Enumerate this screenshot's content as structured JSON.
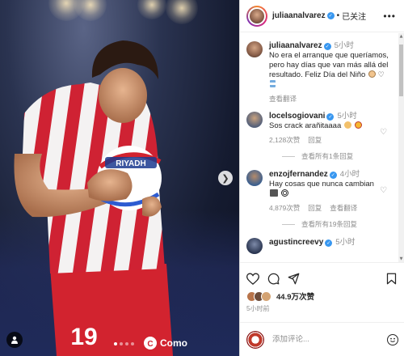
{
  "post": {
    "author": "juliaanalvarez",
    "follow_status": "已关注",
    "separator": "•",
    "more_label": "•••",
    "photo": {
      "jersey_number": "19",
      "sponsor_text": "RIYADH",
      "sleeve_sponsor": "Como",
      "carousel_total": 4,
      "carousel_active": 1
    }
  },
  "comments": [
    {
      "username": "juliaanalvarez",
      "verified": true,
      "time": "5小时",
      "text": "No era el arranque que queríamos, pero hay días que van más allá del resultado. Feliz Día del Niño",
      "emojis": [
        "face-emoji",
        "heart-outline-emoji",
        "flag-emoji"
      ],
      "actions": [
        "查看翻译"
      ],
      "avatar_color": "#a77e62"
    },
    {
      "username": "locelsogiovani",
      "verified": true,
      "time": "5小时",
      "text": "Sos crack arañitaaaa",
      "emojis": [
        "clap-emoji",
        "laugh-emoji"
      ],
      "actions": [
        "2,128次赞",
        "回复"
      ],
      "replies": "查看所有1条回复",
      "avatar_color": "#54607a"
    },
    {
      "username": "enzojfernandez",
      "verified": true,
      "time": "4小时",
      "text": "Hay cosas que nunca cambian",
      "emojis": [
        "goal-emoji",
        "ball-emoji"
      ],
      "actions": [
        "4,879次赞",
        "回复",
        "查看翻译"
      ],
      "replies": "查看所有19条回复",
      "avatar_color": "#3b5f8f"
    },
    {
      "username": "agustincreevy",
      "verified": true,
      "time": "5小时",
      "text": "",
      "emojis": [],
      "actions": [],
      "avatar_color": "#2a3550"
    }
  ],
  "engagement": {
    "likes": "44.9万次赞",
    "posted": "5小时前",
    "like_avatars": [
      "#b8744a",
      "#6d4c3a",
      "#d4a373"
    ]
  },
  "composer": {
    "placeholder": "添加评论..."
  },
  "icons": {
    "like": "heart-icon",
    "comment": "comment-icon",
    "share": "share-icon",
    "save": "bookmark-icon",
    "emoji": "emoji-icon",
    "next": "chevron-right-icon",
    "tag": "user-tag-icon"
  },
  "colors": {
    "verified": "#3897f0",
    "link_gray": "#8e8e8e",
    "text": "#262626"
  }
}
